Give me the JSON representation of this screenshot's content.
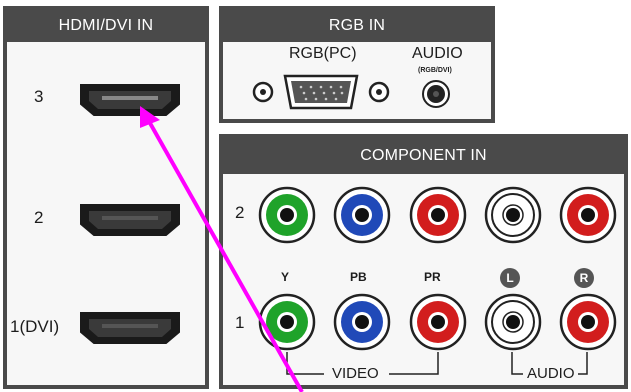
{
  "hdmi_panel": {
    "title": "HDMI/DVI IN",
    "ports": [
      {
        "label": "3"
      },
      {
        "label": "2"
      },
      {
        "label": "1(DVI)"
      }
    ]
  },
  "rgb_panel": {
    "title": "RGB IN",
    "rgb_label": "RGB(PC)",
    "audio_label": "AUDIO",
    "audio_sublabel": "(RGB/DVI)"
  },
  "component_panel": {
    "title": "COMPONENT IN",
    "row_labels": [
      "2",
      "1"
    ],
    "column_labels": [
      "Y",
      "PB",
      "PR"
    ],
    "audio_badges": [
      "L",
      "R"
    ],
    "video_group_label": "VIDEO",
    "audio_group_label": "AUDIO",
    "jack_colors": [
      "#1fa32a",
      "#2049b8",
      "#d21d1d",
      "#ffffff",
      "#d21d1d"
    ]
  },
  "annotation": {
    "arrow_color": "#ff00ff"
  }
}
